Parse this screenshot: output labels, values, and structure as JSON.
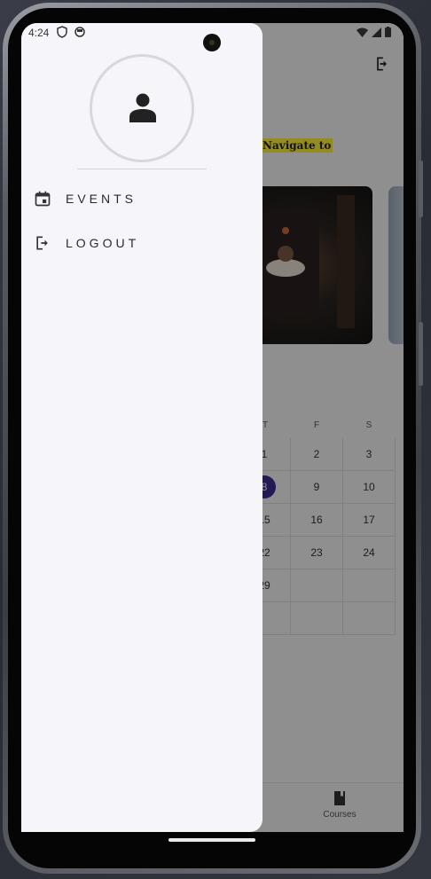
{
  "status_bar": {
    "time": "4:24",
    "left_icons": [
      "shield-icon",
      "notification-icon"
    ],
    "right_icons": [
      "wifi-icon",
      "signal-icon",
      "battery-icon"
    ]
  },
  "background_app": {
    "highlight_text": "Navigate to",
    "calendar": {
      "headers": [
        "T",
        "F",
        "S"
      ],
      "rows": [
        [
          "1",
          "2",
          "3"
        ],
        [
          "8",
          "9",
          "10"
        ],
        [
          "15",
          "16",
          "17"
        ],
        [
          "22",
          "23",
          "24"
        ],
        [
          "29",
          "",
          ""
        ],
        [
          "",
          "",
          ""
        ]
      ],
      "selected_day": "8"
    },
    "bottom_nav": {
      "courses_label": "Courses"
    }
  },
  "drawer": {
    "avatar_icon": "person-icon",
    "items": [
      {
        "label": "EVENTS",
        "icon": "calendar-icon"
      },
      {
        "label": "LOGOUT",
        "icon": "logout-icon"
      }
    ]
  },
  "colors": {
    "drawer_bg": "#f6f5fa",
    "highlight": "#ffef3a",
    "selected_day": "#3f2b8f"
  }
}
